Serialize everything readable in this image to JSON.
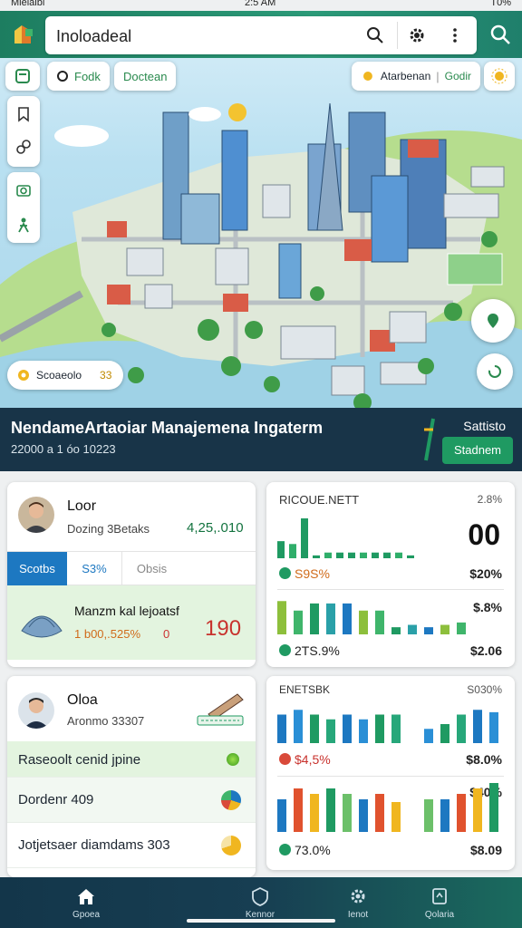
{
  "status": {
    "carrier": "Mielaibl",
    "time": "2:5 AM",
    "battery": "T0%"
  },
  "search": {
    "value": "Inoloadeal"
  },
  "map": {
    "chips_left": [
      "Fodk",
      "Doctean"
    ],
    "chips_right": [
      "Atarbenan",
      "Godir"
    ],
    "location_chip": {
      "label": "Scoaeolo",
      "value": "33"
    }
  },
  "banner": {
    "title": "NendameArtaoiar Manajemena Ingaterm",
    "subtitle": "22000 a 1 óo 10223",
    "status": "Sattisto",
    "button": "Stadnem"
  },
  "card1": {
    "name": "Loor",
    "subtitle": "Dozing 3Betaks",
    "value": "4,25,.010",
    "tabs": [
      "Scotbs",
      "S3%",
      "Obsis"
    ],
    "product": {
      "name": "Manzm kal lejoatsf",
      "detail": "1 b00,.525%",
      "small": "0",
      "value": "190"
    }
  },
  "card2": {
    "name": "Oloa",
    "subtitle": "Aronmo 33307",
    "rows": [
      {
        "label": "Raseoolt cenid jpine",
        "icon": "green-dot-icon"
      },
      {
        "label": "Dordenr 409",
        "icon": "pie-chart-icon"
      },
      {
        "label": "Jotjetsaer diamdams 303",
        "icon": "half-circle-icon"
      }
    ]
  },
  "chart1": {
    "title": "RICOUE.NETT",
    "corner": "2.8%",
    "big": "00",
    "pct1": "S9S%",
    "val1": "$20%",
    "val2": "$.8%",
    "pct2": "2TS.9%",
    "val3": "$2.06"
  },
  "chart2": {
    "title": "ENETSBK",
    "corner": "S030%",
    "pct1": "$4,5%",
    "val1": "$8.0%",
    "val2": "$40%",
    "pct2": "73.0%",
    "val3": "$8.09"
  },
  "chart_data": [
    {
      "type": "bar",
      "series": [
        {
          "values": [
            6,
            5,
            14,
            1,
            2,
            2,
            2,
            2,
            2,
            2,
            2,
            1
          ]
        },
        {
          "values": [
            14,
            10,
            13,
            13,
            13,
            10,
            10,
            3,
            4,
            3,
            4,
            5
          ]
        }
      ]
    },
    {
      "type": "bar",
      "series": [
        {
          "values": [
            12,
            14,
            12,
            10,
            12,
            10,
            12,
            12,
            0,
            6,
            8,
            12,
            14,
            13
          ]
        },
        {
          "values": [
            12,
            16,
            14,
            16,
            14,
            12,
            14,
            11,
            0,
            12,
            12,
            14,
            16,
            18
          ]
        }
      ]
    }
  ],
  "nav": [
    "Gpoea",
    "Kennor",
    "Ienot",
    "Qolaria"
  ],
  "colors": {
    "accent": "#2b9a78",
    "banner": "#183448",
    "tab": "#1d78c1",
    "green": "#1f9a62"
  }
}
